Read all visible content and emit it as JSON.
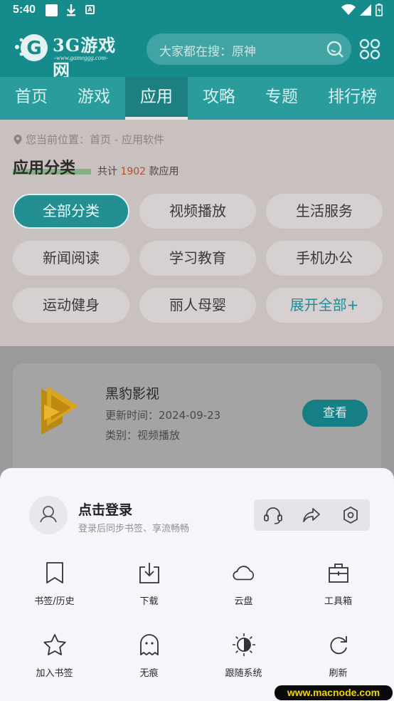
{
  "status_bar": {
    "time": "5:40"
  },
  "header": {
    "logo_text": "3G游戏网",
    "logo_sub": "-www.gameggg.com-",
    "search_placeholder": "大家都在搜：原神"
  },
  "nav": {
    "items": [
      "首页",
      "游戏",
      "应用",
      "攻略",
      "专题",
      "排行榜"
    ],
    "active_index": 2
  },
  "breadcrumb": "您当前位置：首页 - 应用软件",
  "section": {
    "title": "应用分类",
    "count_prefix": "共计",
    "count": "1902",
    "count_suffix": "款应用"
  },
  "categories": [
    "全部分类",
    "视频播放",
    "生活服务",
    "新闻阅读",
    "学习教育",
    "手机办公",
    "运动健身",
    "丽人母婴",
    "展开全部+"
  ],
  "app_card": {
    "name": "黑豹影视",
    "updated": "更新时间：2024-09-23",
    "category": "类别：视频播放",
    "button": "查看"
  },
  "sheet": {
    "login_title": "点击登录",
    "login_sub": "登录后同步书签、享流畅畅",
    "menu": [
      {
        "label": "书签/历史",
        "icon": "bookmark-icon"
      },
      {
        "label": "下载",
        "icon": "download-icon"
      },
      {
        "label": "云盘",
        "icon": "cloud-icon"
      },
      {
        "label": "工具箱",
        "icon": "toolbox-icon"
      },
      {
        "label": "加入书签",
        "icon": "star-icon"
      },
      {
        "label": "无痕",
        "icon": "ghost-icon"
      },
      {
        "label": "跟随系统",
        "icon": "theme-icon"
      },
      {
        "label": "刷新",
        "icon": "refresh-icon"
      }
    ]
  },
  "watermark": "www.macnode.com",
  "colors": {
    "teal_header": "#168b8b",
    "accent_orange": "#b4522c",
    "sheet_bg": "#f4f6fc"
  }
}
